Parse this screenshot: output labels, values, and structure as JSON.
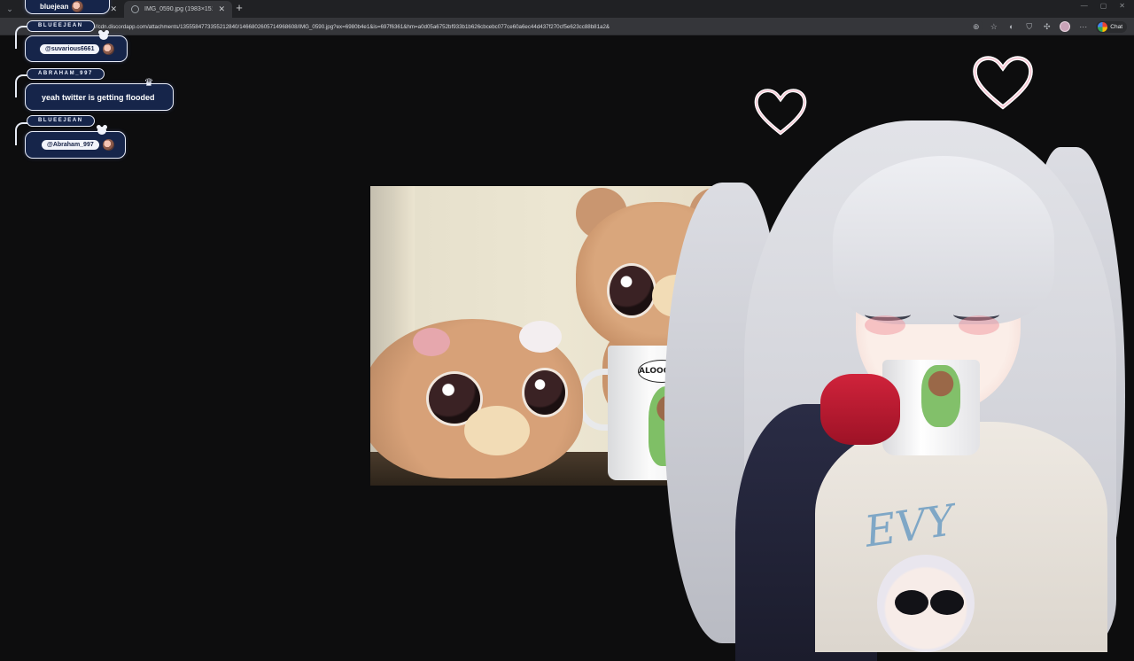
{
  "browser": {
    "tabs": [
      {
        "title": "",
        "active": false
      },
      {
        "title": "IMG_0590.jpg (1983×1512)",
        "active": true
      }
    ],
    "new_tab_icon": "plus-icon",
    "url": "https://cdn.discordapp.com/attachments/1355584773355212840/1466802605714968608/IMG_0590.jpg?ex=6980b4e1&is=697f6361&hm=a0d05a6752bf933b1b626cbcebc077ce60a6ec44d437f270cf5e623cc88b81a2&",
    "toolbar_icons": [
      "zoom-icon",
      "star-icon",
      "extensions-icon",
      "puzzle-icon",
      "profile-icon",
      "menu-icon"
    ],
    "chat_button_label": "Chat"
  },
  "chat": {
    "top_message": {
      "username": "bluejean"
    },
    "messages": [
      {
        "username": "BLUEEJEAN",
        "mention": "@suvarious6661",
        "badge": "bear-icon"
      },
      {
        "username": "ABRAHAM_997",
        "text": "yeah twitter is getting flooded",
        "badge": "crown-icon"
      },
      {
        "username": "BLUEEJEAN",
        "mention": "@Abraham_997",
        "badge": "bear-icon"
      }
    ]
  },
  "photo": {
    "mug_speech": "ALOOOOO~"
  },
  "avatar": {
    "shirt_text": "EVY"
  }
}
